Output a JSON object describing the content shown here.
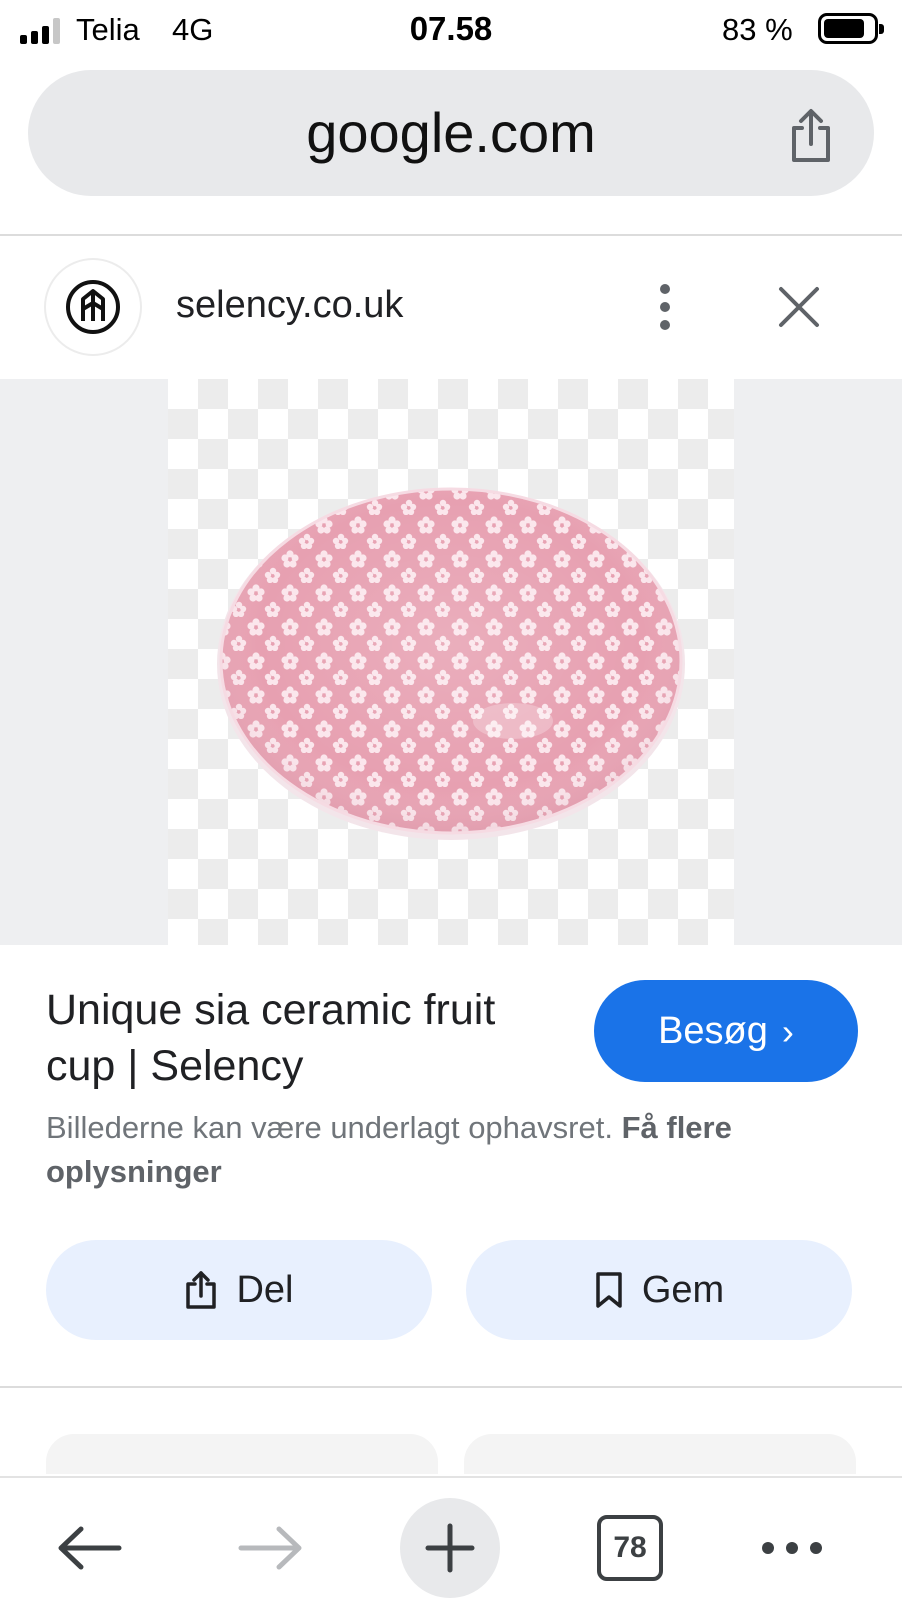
{
  "status_bar": {
    "carrier": "Telia",
    "network": "4G",
    "time": "07.58",
    "battery_percent": "83 %",
    "battery_level": 0.83
  },
  "url_bar": {
    "url": "google.com",
    "share_icon": "share-icon"
  },
  "site": {
    "name": "selency.co.uk",
    "logo_icon": "selency-logo-icon",
    "menu_icon": "more-vertical-icon",
    "close_icon": "close-icon"
  },
  "image": {
    "subject": "pink floral ceramic bowl",
    "background": "transparency checkerboard",
    "bowl_color": "#e8a4b4"
  },
  "result": {
    "title": "Unique sia ceramic fruit cup | Selency",
    "visit_label": "Besøg",
    "visit_chevron": "›",
    "copyright_text": "Billederne kan være underlagt ophavsret.",
    "copyright_link": "Få flere oplysninger"
  },
  "actions": {
    "share_label": "Del",
    "save_label": "Gem"
  },
  "toolbar": {
    "back_icon": "arrow-left-icon",
    "forward_icon": "arrow-right-icon",
    "new_tab_icon": "plus-icon",
    "tab_count": "78",
    "more_icon": "more-horizontal-icon"
  },
  "colors": {
    "accent": "#1a73e8",
    "chip_background": "#e8f0fe",
    "url_bar_background": "#e8e9eb"
  }
}
